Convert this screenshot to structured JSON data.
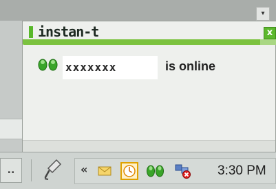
{
  "notification": {
    "brand": "instan-t",
    "close_glyph": "x",
    "buddy_name": "xxxxxxx",
    "status": "is online",
    "buddy_icon": "green-buddy-icon"
  },
  "desktop": {
    "scroll_arrow_glyph": "▾"
  },
  "taskbar": {
    "left_button_glyph": "..",
    "tray": {
      "expand_glyph": "«",
      "icons": [
        "mail-icon",
        "clock-icon",
        "green-buddy-icon",
        "network-error-icon"
      ],
      "clock": "3:30 PM"
    }
  },
  "colors": {
    "accent_green": "#7bc23f",
    "brand_mark": "#58b82a",
    "popup_bg": "#eef0ed",
    "taskbar_bg": "#cfd4d1"
  }
}
